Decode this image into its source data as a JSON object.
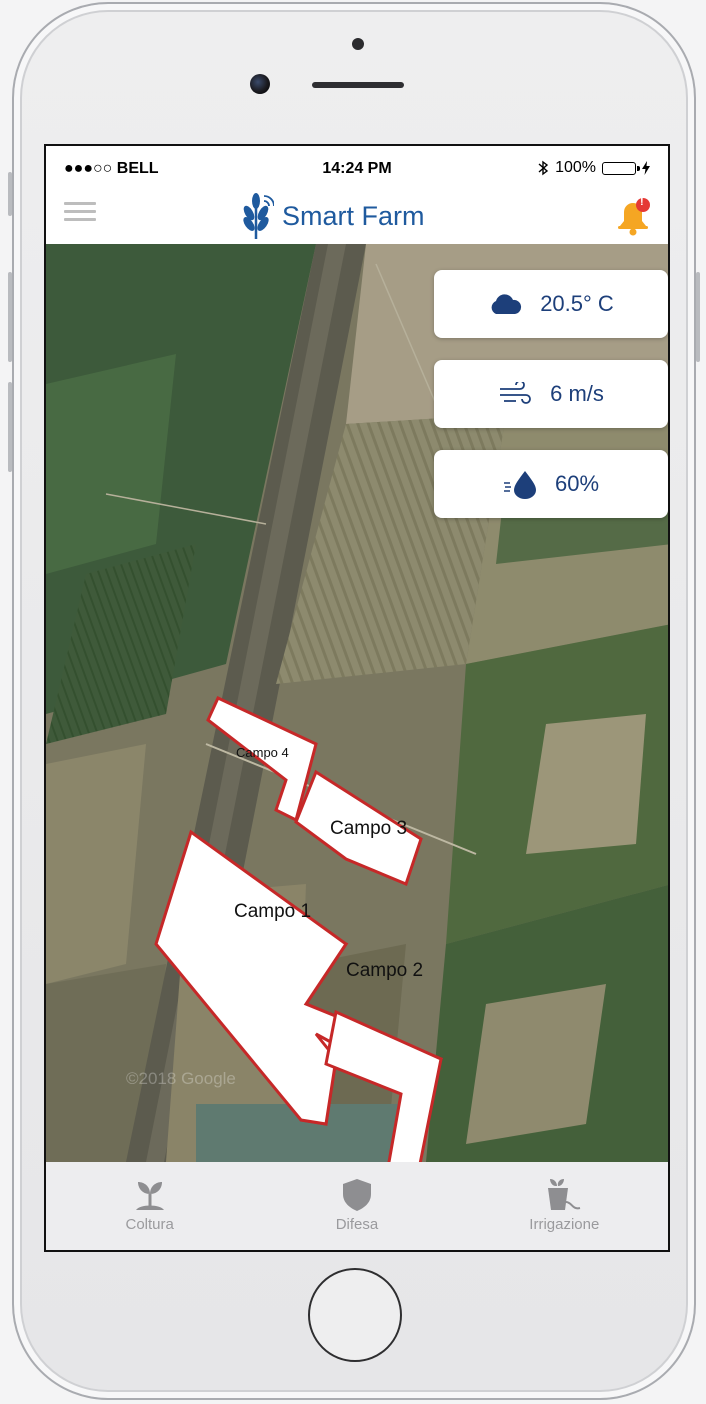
{
  "status_bar": {
    "carrier": "●●●○○ BELL",
    "time": "14:24 PM",
    "bluetooth_icon": "bluetooth-icon",
    "battery": "100%"
  },
  "header": {
    "title": "Smart Farm",
    "menu_icon": "hamburger-menu-icon",
    "logo_icon": "wheat-signal-logo-icon",
    "notification_icon": "bell-icon",
    "notification_badge": "!"
  },
  "weather": {
    "temperature": "20.5° C",
    "wind": "6 m/s",
    "humidity": "60%"
  },
  "map": {
    "watermark": "©2018 Google",
    "fields": [
      {
        "label": "Campo 1"
      },
      {
        "label": "Campo 2"
      },
      {
        "label": "Campo 3"
      },
      {
        "label": "Campo 4"
      }
    ]
  },
  "tabs": [
    {
      "label": "Coltura",
      "icon": "sprout-icon"
    },
    {
      "label": "Difesa",
      "icon": "shield-icon"
    },
    {
      "label": "Irrigazione",
      "icon": "plant-pot-watering-icon"
    }
  ],
  "colors": {
    "brand_blue": "#1f5a9e",
    "weather_text": "#1d3f7a",
    "bell": "#f5a623",
    "badge": "#e53935",
    "field_border": "#c62828"
  }
}
